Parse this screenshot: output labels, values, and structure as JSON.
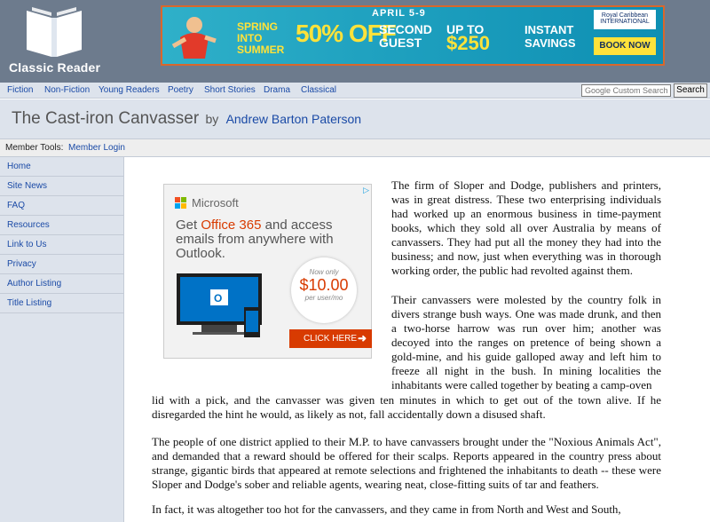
{
  "site": {
    "name": "Classic Reader"
  },
  "banner": {
    "dates": "APRIL 5-9",
    "spring": "SPRING INTO SUMMER",
    "offer_pct": "50% OFF",
    "second": "SECOND GUEST",
    "upto": "UP TO",
    "amount": "$250",
    "instant": "INSTANT SAVINGS",
    "brand": "Royal Caribbean INTERNATIONAL",
    "cta": "BOOK NOW"
  },
  "nav": {
    "items": [
      "Fiction",
      "Non-Fiction",
      "Young Readers",
      "Poetry",
      "Short Stories",
      "Drama",
      "Classical"
    ],
    "search_placeholder": "Google Custom Search",
    "search_button": "Search"
  },
  "book": {
    "title": "The Cast-iron Canvasser",
    "by": "by",
    "author": "Andrew Barton Paterson"
  },
  "member_tools": {
    "label": "Member Tools:",
    "login": "Member Login"
  },
  "sidebar": {
    "items": [
      "Home",
      "Site News",
      "FAQ",
      "Resources",
      "Link to Us",
      "Privacy",
      "Author Listing",
      "Title Listing"
    ]
  },
  "ad": {
    "brand": "Microsoft",
    "headline_pre": "Get ",
    "headline_product": "Office 365",
    "headline_post": " and access emails from anywhere with Outlook.",
    "price_label": "Now only",
    "price": "$10.00",
    "price_unit": "per user/mo",
    "cta": "CLICK HERE",
    "colors": {
      "accent": "#d83b01",
      "laptop": "#0072c6"
    }
  },
  "article": {
    "paragraphs": [
      "The firm of Sloper and Dodge, publishers and printers, was in great distress. These two enterprising individuals had worked up an enormous business in time-payment books, which they sold all over Australia by means of canvassers. They had put all the money they had into the business; and now, just when everything was in thorough working order, the public had revolted against them.",
      "Their canvassers were molested by the country folk in divers strange bush ways. One was made drunk, and then a two-horse harrow was run over him; another was decoyed into the ranges on pretence of being shown a gold-mine, and his guide galloped away and left him to freeze all night in the bush. In mining localities the inhabitants were called together by beating a camp-oven",
      "lid with a pick, and the canvasser was given ten minutes in which to get out of the town alive. If he disregarded the hint he would, as likely as not, fall accidentally down a disused shaft.",
      "The people of one district applied to their M.P. to have canvassers brought under the \"Noxious Animals Act\", and demanded that a reward should be offered for their scalps. Reports appeared in the country press about strange, gigantic birds that appeared at remote selections and frightened the inhabitants to death -- these were Sloper and Dodge's sober and reliable agents, wearing neat, close-fitting suits of tar and feathers.",
      "In fact, it was altogether too hot for the canvassers, and they came in from North and West and South,"
    ]
  }
}
